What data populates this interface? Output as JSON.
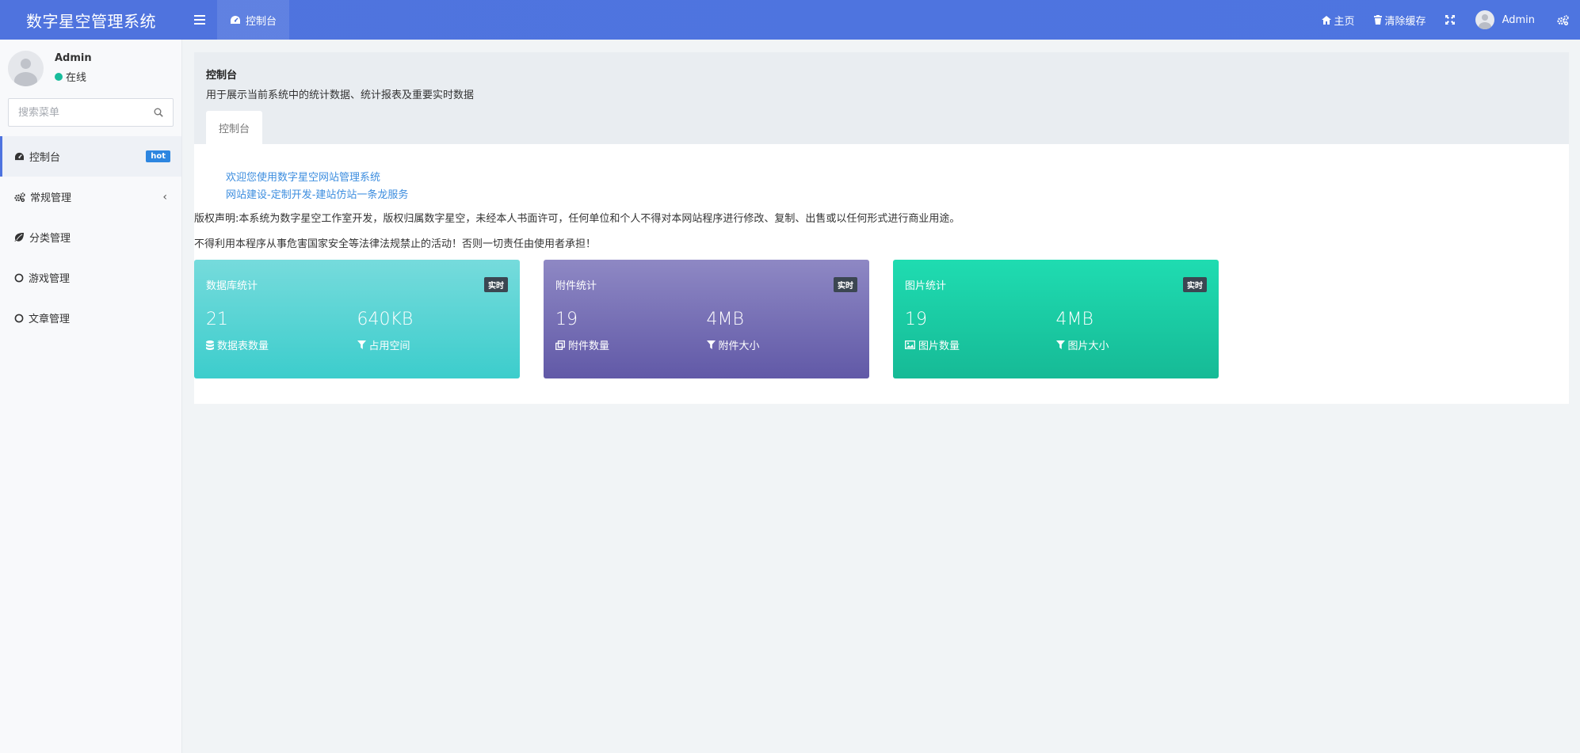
{
  "header": {
    "brand": "数字星空管理系统",
    "tab_label": "控制台",
    "home_label": "主页",
    "clear_cache_label": "清除缓存",
    "user_name": "Admin"
  },
  "sidebar": {
    "user_name": "Admin",
    "user_status": "在线",
    "search_placeholder": "搜索菜单",
    "items": [
      {
        "label": "控制台",
        "badge": "hot",
        "icon": "dashboard-icon",
        "active": true
      },
      {
        "label": "常规管理",
        "icon": "cogs-icon",
        "has_children": true
      },
      {
        "label": "分类管理",
        "icon": "leaf-icon"
      },
      {
        "label": "游戏管理",
        "icon": "circle-icon"
      },
      {
        "label": "文章管理",
        "icon": "circle-icon"
      }
    ]
  },
  "panel": {
    "title": "控制台",
    "description": "用于展示当前系统中的统计数据、统计报表及重要实时数据",
    "tab_label": "控制台"
  },
  "welcome": {
    "line1": "欢迎您使用数字星空网站管理系统",
    "line2": "网站建设-定制开发-建站仿站一条龙服务"
  },
  "notices": {
    "copyright": "版权声明:本系统为数字星空工作室开发，版权归属数字星空，未经本人书面许可，任何单位和个人不得对本网站程序进行修改、复制、出售或以任何形式进行商业用途。",
    "warning": "不得利用本程序从事危害国家安全等法律法规禁止的活动！否则一切责任由使用者承担！"
  },
  "cards": [
    {
      "title": "数据库统计",
      "badge": "实时",
      "stat1_value": "21",
      "stat1_label": "数据表数量",
      "stat2_value": "640KB",
      "stat2_label": "占用空间",
      "gradient": [
        "#76dbdc",
        "#3ccdcc"
      ]
    },
    {
      "title": "附件统计",
      "badge": "实时",
      "stat1_value": "19",
      "stat1_label": "附件数量",
      "stat2_value": "4MB",
      "stat2_label": "附件大小",
      "gradient": [
        "#8e88c4",
        "#6159a7"
      ]
    },
    {
      "title": "图片统计",
      "badge": "实时",
      "stat1_value": "19",
      "stat1_label": "图片数量",
      "stat2_value": "4MB",
      "stat2_label": "图片大小",
      "gradient": [
        "#1fdcb1",
        "#16ba96"
      ]
    }
  ],
  "colors": {
    "header_bg": "#4e73df",
    "active_accent": "#4e73df",
    "online_dot": "#18bc9c",
    "hot_badge": "#2d86e0",
    "link": "#3c8ddf"
  }
}
